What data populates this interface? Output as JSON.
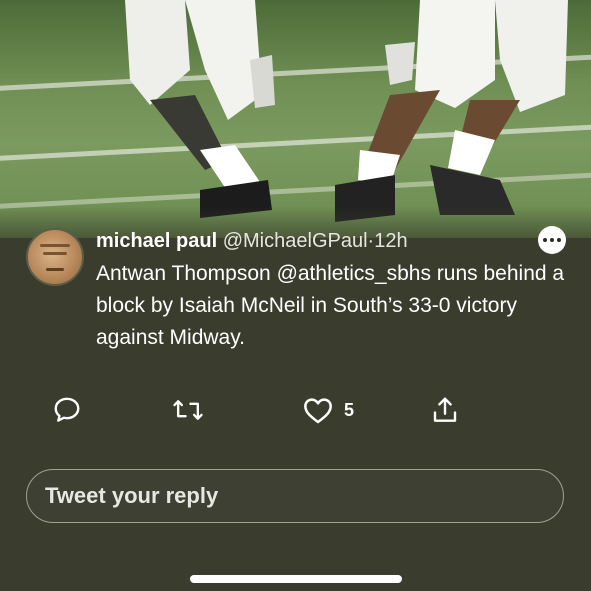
{
  "tweet": {
    "display_name": "michael paul",
    "handle": "@MichaelGPaul",
    "separator": "·",
    "time": "12h",
    "text_parts": {
      "line_start": "Antwan Thompson ",
      "mention": "@athletics_sbhs",
      "rest": " runs behind a block by Isaiah McNeil in South’s 33-0 victory against Midway."
    }
  },
  "actions": {
    "reply_icon": "comment-icon",
    "retweet_icon": "retweet-icon",
    "like_icon": "heart-icon",
    "like_count": "5",
    "share_icon": "share-icon"
  },
  "reply": {
    "placeholder": "Tweet your reply"
  },
  "colors": {
    "background": "#3a3d2e",
    "text": "#ffffff",
    "reply_border": "#9fa293"
  }
}
